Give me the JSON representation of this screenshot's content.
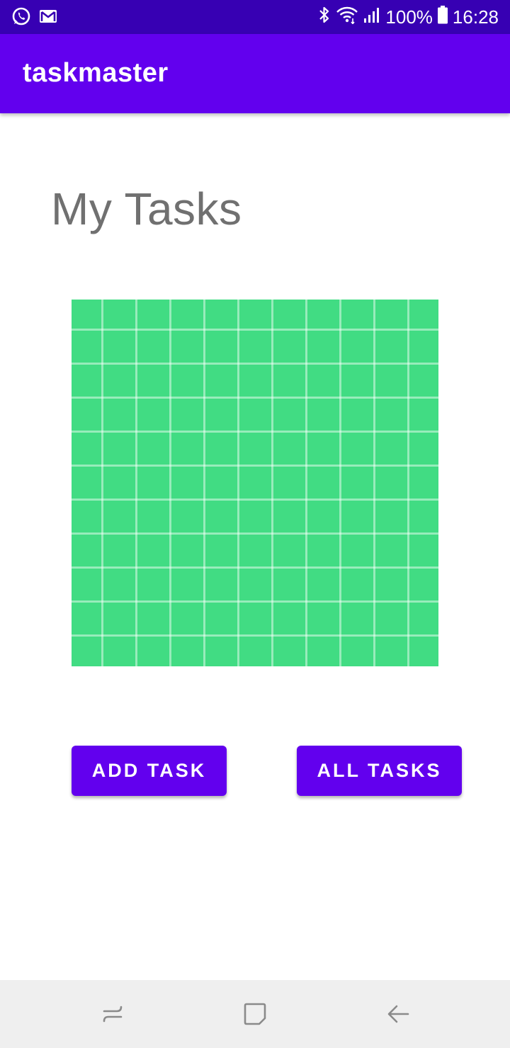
{
  "status_bar": {
    "notification_icons": [
      "whatsapp-icon",
      "gmail-icon"
    ],
    "system_icons": [
      "bluetooth-icon",
      "wifi-icon",
      "signal-icon",
      "battery-icon"
    ],
    "battery": "100%",
    "time": "16:28"
  },
  "app_bar": {
    "title": "taskmaster"
  },
  "main": {
    "heading": "My Tasks",
    "image": "green-grid-image",
    "buttons": {
      "add_task": "ADD TASK",
      "all_tasks": "ALL TASKS"
    }
  },
  "nav_bar": {
    "items": [
      "recent-apps-icon",
      "home-icon",
      "back-icon"
    ]
  },
  "colors": {
    "status_bar": "#3700b3",
    "primary": "#6200ee",
    "heading_text": "#707070",
    "image_green": "#41dc83",
    "nav_background": "#efefef"
  }
}
